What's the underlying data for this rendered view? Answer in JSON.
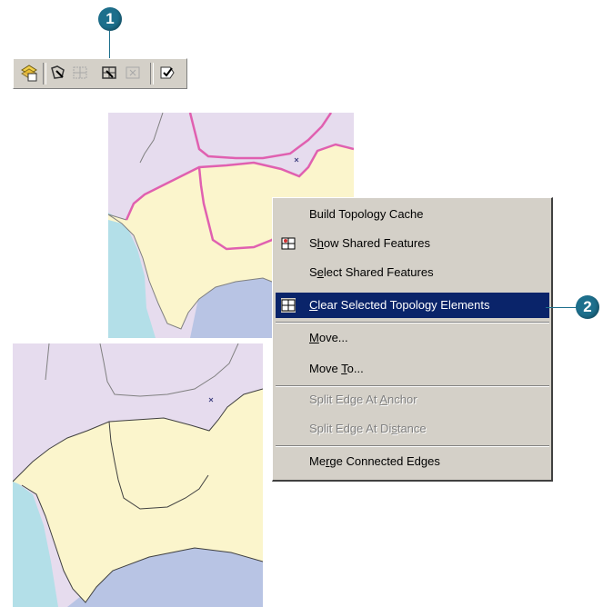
{
  "callouts": {
    "one": "1",
    "two": "2"
  },
  "toolbar": {
    "buttons": [
      {
        "name": "topology-tool-button",
        "icon": "topology-layer-icon"
      },
      {
        "name": "topology-edit-tool-button",
        "icon": "topology-edit-icon"
      },
      {
        "name": "shared-features-button",
        "icon": "shared-features-icon"
      },
      {
        "name": "show-shared-features-button",
        "icon": "show-shared-icon"
      },
      {
        "name": "reshape-edge-button",
        "icon": "reshape-edge-icon"
      },
      {
        "name": "validate-topology-button",
        "icon": "validate-icon"
      }
    ]
  },
  "menu": {
    "items": [
      {
        "pre": "Build Topology Cache",
        "key": "",
        "post": "",
        "disabled": false
      },
      {
        "pre": "S",
        "key": "h",
        "post": "ow Shared Features",
        "disabled": false
      },
      {
        "pre": "S",
        "key": "e",
        "post": "lect Shared Features",
        "disabled": false
      },
      {
        "pre": "",
        "key": "C",
        "post": "lear Selected Topology Elements",
        "disabled": false,
        "highlighted": true
      },
      {
        "pre": "",
        "key": "M",
        "post": "ove...",
        "disabled": false
      },
      {
        "pre": "Move ",
        "key": "T",
        "post": "o...",
        "disabled": false
      },
      {
        "pre": "Split Edge At ",
        "key": "A",
        "post": "nchor",
        "disabled": true
      },
      {
        "pre": "Split Edge At Di",
        "key": "s",
        "post": "tance",
        "disabled": true
      },
      {
        "pre": "Me",
        "key": "r",
        "post": "ge Connected Edges",
        "disabled": false
      }
    ]
  },
  "colors": {
    "highlight": "#0a246a",
    "callout": "#1d6f8c",
    "selected_edge": "#e060b0",
    "lilac_region": "#e6dcee",
    "yellow_region": "#fbf5cc",
    "cyan_region": "#b3dfe8",
    "blue_region": "#b8c4e4"
  }
}
